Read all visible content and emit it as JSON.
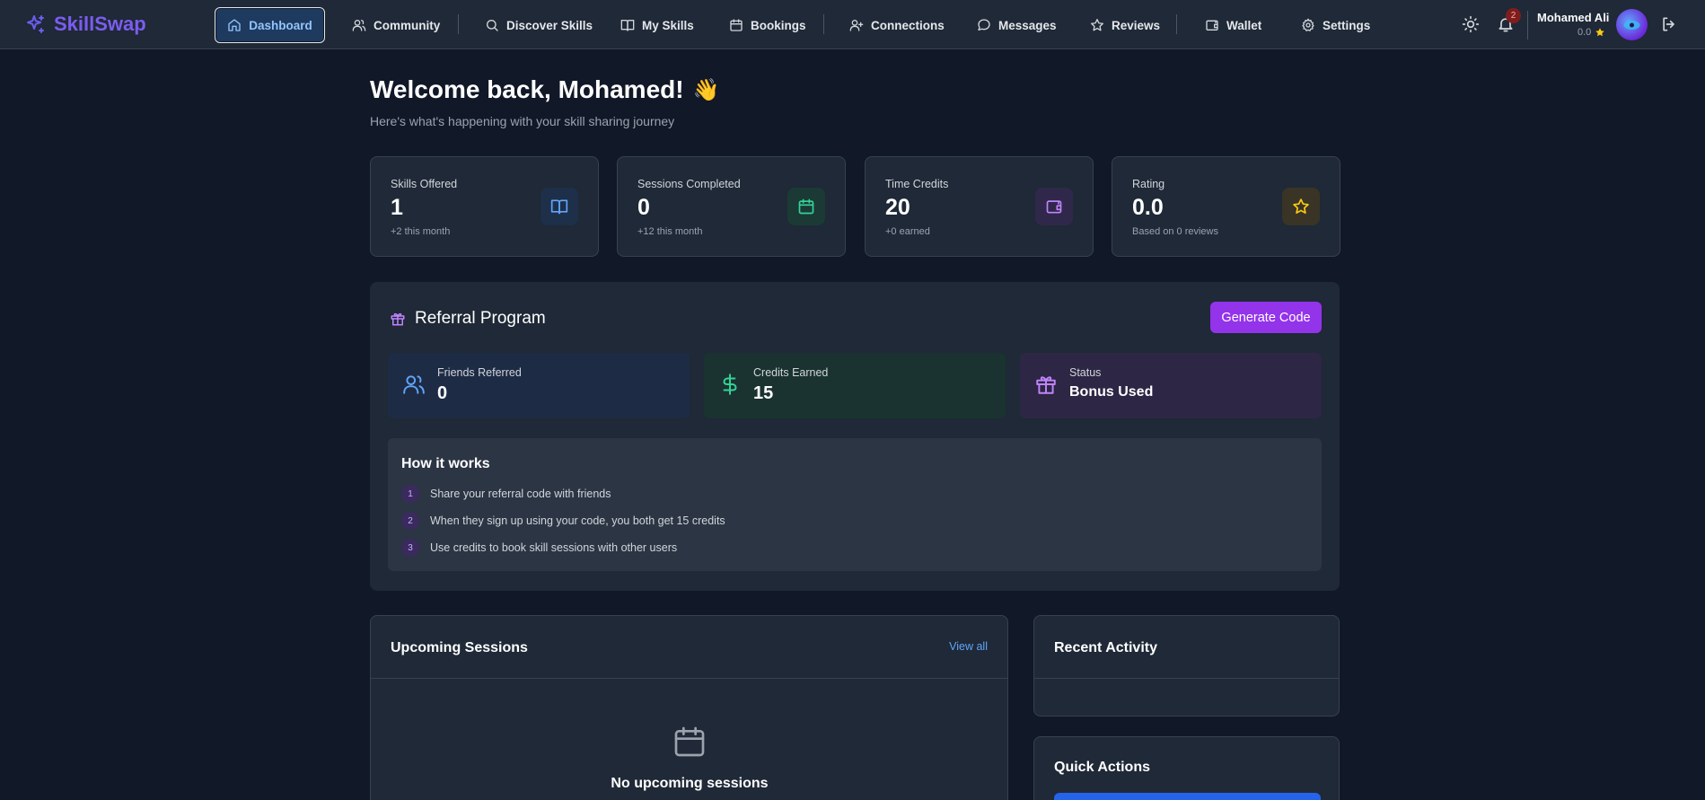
{
  "brand": {
    "name": "SkillSwap",
    "color": "#7c5cf0"
  },
  "nav": {
    "items": [
      {
        "label": "Dashboard",
        "icon": "home-icon"
      },
      {
        "label": "Community",
        "icon": "users-icon"
      },
      {
        "label": "Discover Skills",
        "icon": "search-icon"
      },
      {
        "label": "My Skills",
        "icon": "book-icon"
      },
      {
        "label": "Bookings",
        "icon": "calendar-icon"
      },
      {
        "label": "Connections",
        "icon": "user-plus-icon"
      },
      {
        "label": "Messages",
        "icon": "message-icon"
      },
      {
        "label": "Reviews",
        "icon": "star-icon"
      },
      {
        "label": "Wallet",
        "icon": "wallet-icon"
      },
      {
        "label": "Settings",
        "icon": "gear-icon"
      }
    ],
    "active": "Dashboard"
  },
  "user": {
    "name": "Mohamed Ali",
    "rating": "0.0",
    "notifications": "2"
  },
  "header": {
    "welcome": "Welcome back, Mohamed!",
    "emoji": "👋",
    "subtitle": "Here's what's happening with your skill sharing journey"
  },
  "stats": [
    {
      "label": "Skills Offered",
      "value": "1",
      "sub": "+2 this month",
      "icon": "book-icon",
      "color": "#60a5fa",
      "bg": "#1e2f4a"
    },
    {
      "label": "Sessions Completed",
      "value": "0",
      "sub": "+12 this month",
      "icon": "calendar-icon",
      "color": "#34d399",
      "bg": "#1b3a35"
    },
    {
      "label": "Time Credits",
      "value": "20",
      "sub": "+0 earned",
      "icon": "wallet-icon",
      "color": "#c084fc",
      "bg": "#30284a"
    },
    {
      "label": "Rating",
      "value": "0.0",
      "sub": "Based on 0 reviews",
      "icon": "star-icon",
      "color": "#facc15",
      "bg": "#3a3426"
    }
  ],
  "referral": {
    "title": "Referral Program",
    "button": "Generate Code",
    "boxes": [
      {
        "label": "Friends Referred",
        "value": "0",
        "icon": "users-icon"
      },
      {
        "label": "Credits Earned",
        "value": "15",
        "icon": "dollar-icon"
      },
      {
        "label": "Status",
        "value": "Bonus Used",
        "icon": "gift-icon"
      }
    ],
    "how_title": "How it works",
    "steps": [
      {
        "num": "1",
        "text": "Share your referral code with friends"
      },
      {
        "num": "2",
        "text": "When they sign up using your code, you both get 15 credits"
      },
      {
        "num": "3",
        "text": "Use credits to book skill sessions with other users"
      }
    ]
  },
  "upcoming": {
    "title": "Upcoming Sessions",
    "view_all": "View all",
    "empty": "No upcoming sessions"
  },
  "activity": {
    "title": "Recent Activity"
  },
  "quick_actions": {
    "title": "Quick Actions"
  }
}
